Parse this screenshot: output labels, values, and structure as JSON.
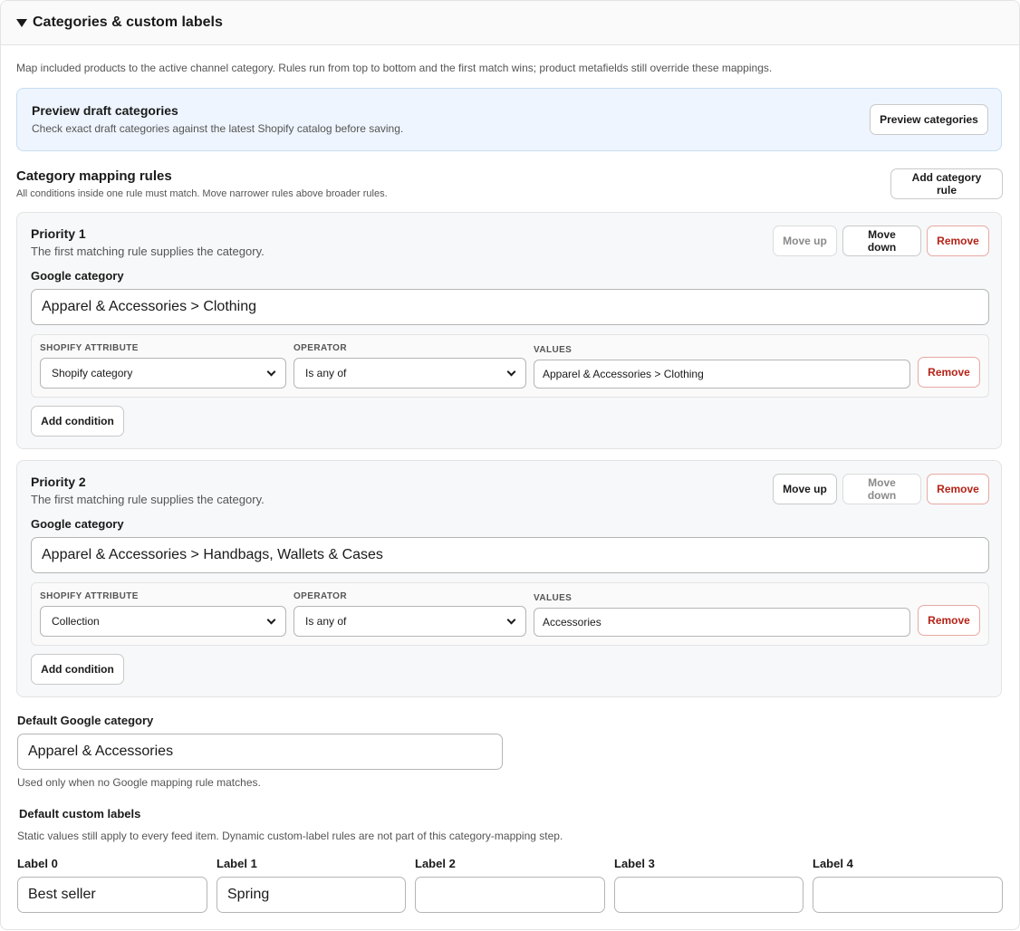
{
  "header": {
    "title": "Categories & custom labels"
  },
  "intro": "Map included products to the active channel category. Rules run from top to bottom and the first match wins; product metafields still override these mappings.",
  "preview": {
    "title": "Preview draft categories",
    "description": "Check exact draft categories against the latest Shopify catalog before saving.",
    "button": "Preview categories"
  },
  "mapping": {
    "title": "Category mapping rules",
    "subtitle": "All conditions inside one rule must match. Move narrower rules above broader rules.",
    "add_rule": "Add category rule"
  },
  "rules": [
    {
      "title": "Priority 1",
      "subtitle": "The first matching rule supplies the category.",
      "move_up": "Move up",
      "move_up_disabled": true,
      "move_down": "Move down",
      "move_down_disabled": false,
      "remove": "Remove",
      "google_label": "Google category",
      "google_value": "Apparel & Accessories > Clothing",
      "cond_headers": {
        "attribute": "SHOPIFY ATTRIBUTE",
        "operator": "OPERATOR",
        "values": "VALUES"
      },
      "condition": {
        "attribute": "Shopify category",
        "operator": "Is any of",
        "values": "Apparel & Accessories > Clothing",
        "remove": "Remove"
      },
      "add_condition": "Add condition"
    },
    {
      "title": "Priority 2",
      "subtitle": "The first matching rule supplies the category.",
      "move_up": "Move up",
      "move_up_disabled": false,
      "move_down": "Move down",
      "move_down_disabled": true,
      "remove": "Remove",
      "google_label": "Google category",
      "google_value": "Apparel & Accessories > Handbags, Wallets & Cases",
      "cond_headers": {
        "attribute": "SHOPIFY ATTRIBUTE",
        "operator": "OPERATOR",
        "values": "VALUES"
      },
      "condition": {
        "attribute": "Collection",
        "operator": "Is any of",
        "values": "Accessories",
        "remove": "Remove"
      },
      "add_condition": "Add condition"
    }
  ],
  "default_category": {
    "label": "Default Google category",
    "value": "Apparel & Accessories",
    "help": "Used only when no Google mapping rule matches."
  },
  "custom_labels": {
    "title": "Default custom labels",
    "help": "Static values still apply to every feed item. Dynamic custom-label rules are not part of this category-mapping step.",
    "labels": [
      {
        "label": "Label 0",
        "value": "Best seller"
      },
      {
        "label": "Label 1",
        "value": "Spring"
      },
      {
        "label": "Label 2",
        "value": ""
      },
      {
        "label": "Label 3",
        "value": ""
      },
      {
        "label": "Label 4",
        "value": ""
      }
    ]
  }
}
